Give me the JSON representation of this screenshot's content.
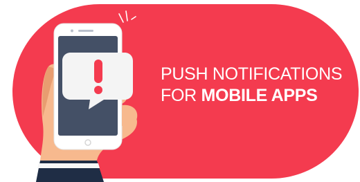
{
  "banner": {
    "background_color": "#f43b4f",
    "headline": {
      "line1": "PUSH NOTIFICATIONS",
      "line2_prefix": "FOR ",
      "line2_emphasis": "MOBILE APPS"
    }
  },
  "illustration": {
    "device": "smartphone",
    "screen_color": "#445066",
    "notification_icon": "exclamation-icon"
  }
}
